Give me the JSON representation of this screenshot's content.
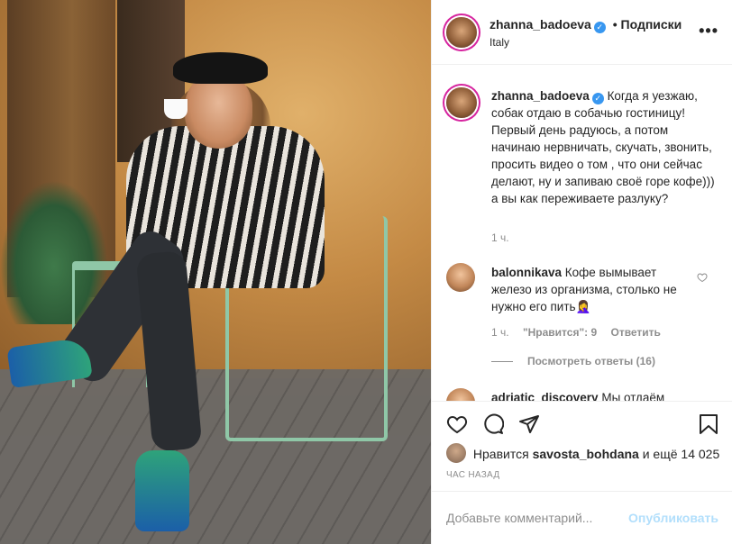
{
  "post": {
    "author": "zhanna_badoeva",
    "follow_label": "• Подписки",
    "location": "Italy",
    "more_icon": "•••"
  },
  "caption": {
    "author": "zhanna_badoeva",
    "text": "Когда я уезжаю, собак отдаю в собачью гостиницу! Первый день радуюсь, а потом начинаю нервничать, скучать, звонить, просить видео о том , что они сейчас делают, ну и запиваю своё горе кофе))) а вы как переживаете разлуку?",
    "time": "1 ч."
  },
  "comments": [
    {
      "author": "balonnikava",
      "text": "Кофе вымывает железо из организма, столько не нужно его пить🤦‍♀️",
      "time": "1 ч.",
      "likes_label": "\"Нравится\": 9",
      "reply_label": "Ответить",
      "view_replies": "Посмотреть ответы (16)"
    },
    {
      "author": "adriatic_discovery",
      "text": "Мы отдаём"
    }
  ],
  "likes": {
    "prefix": "Нравится",
    "user": "savosta_bohdana",
    "suffix": "и ещё 14 025"
  },
  "timestamp": "ЧАС НАЗАД",
  "comment_box": {
    "placeholder": "Добавьте комментарий...",
    "publish_label": "Опубликовать"
  },
  "colors": {
    "accent": "#3897f0",
    "publish_disabled": "#b2dffc",
    "muted": "#8e8e8e"
  }
}
